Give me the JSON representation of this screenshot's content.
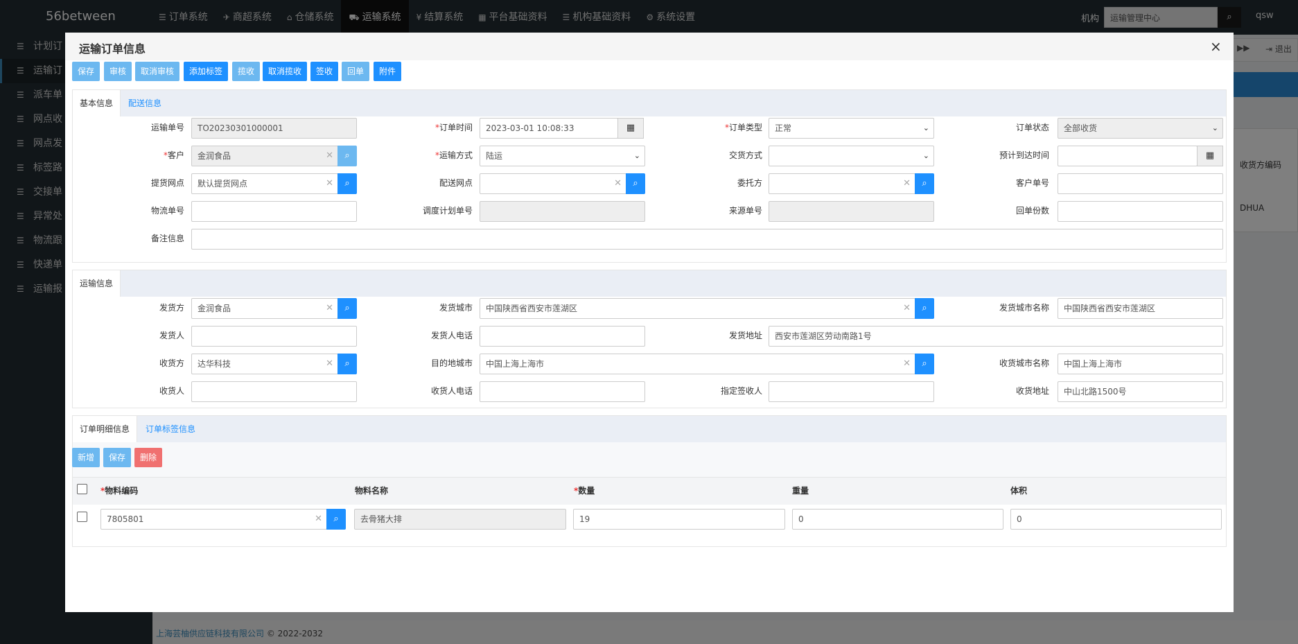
{
  "app": {
    "brand": "56between",
    "nav": [
      {
        "icon": "☰",
        "label": "订单系统"
      },
      {
        "icon": "✈",
        "label": "商超系统"
      },
      {
        "icon": "⌂",
        "label": "仓储系统"
      },
      {
        "icon": "⛟",
        "label": "运输系统"
      },
      {
        "icon": "¥",
        "label": "结算系统"
      },
      {
        "icon": "▦",
        "label": "平台基础资料"
      },
      {
        "icon": "☰",
        "label": "机构基础资料"
      },
      {
        "icon": "⚙",
        "label": "系统设置"
      }
    ],
    "org_label": "机构",
    "org_value": "运输管理中心",
    "user": "qsw",
    "sidebar": [
      "计划订",
      "运输订",
      "派车单",
      "网点收",
      "网点发",
      "标签路",
      "交接单",
      "异常处",
      "物流跟",
      "快递单",
      "运输报"
    ],
    "bg": {
      "next": "▶▶",
      "logout": "⇥ 退出",
      "col_header": "收货方编码",
      "cell": "DHUA"
    },
    "footer_company": "上海芸柚供应链科技有限公司",
    "footer_copyright": "© 2022-2032"
  },
  "modal": {
    "title": "运输订单信息",
    "close": "×",
    "toolbar": [
      "保存",
      "审核",
      "取消审核",
      "添加标签",
      "揽收",
      "取消揽收",
      "签收",
      "回单",
      "附件"
    ],
    "basic_tabs": [
      "基本信息",
      "配送信息"
    ],
    "basic": {
      "waybill_no_label": "运输单号",
      "waybill_no": "TO20230301000001",
      "order_time_label": "订单时间",
      "order_time": "2023-03-01 10:08:33",
      "order_type_label": "订单类型",
      "order_type": "正常",
      "order_status_label": "订单状态",
      "order_status": "全部收货",
      "customer_label": "客户",
      "customer": "金润食品",
      "transport_mode_label": "运输方式",
      "transport_mode": "陆运",
      "delivery_mode_label": "交货方式",
      "delivery_mode": "",
      "eta_label": "预计到达时间",
      "eta": "",
      "pickup_point_label": "提货网点",
      "pickup_point": "默认提货网点",
      "dispatch_point_label": "配送网点",
      "dispatch_point": "",
      "consignor_label": "委托方",
      "consignor": "",
      "customer_no_label": "客户单号",
      "customer_no": "",
      "logistics_no_label": "物流单号",
      "logistics_no": "",
      "plan_no_label": "调度计划单号",
      "plan_no": "",
      "source_no_label": "来源单号",
      "source_no": "",
      "receipt_copies_label": "回单份数",
      "receipt_copies": "",
      "remark_label": "备注信息",
      "remark": ""
    },
    "transport_tab": "运输信息",
    "transport": {
      "shipper_label": "发货方",
      "shipper": "金润食品",
      "ship_city_label": "发货城市",
      "ship_city": "中国陕西省西安市莲湖区",
      "ship_city_name_label": "发货城市名称",
      "ship_city_name": "中国陕西省西安市莲湖区",
      "sender_label": "发货人",
      "sender": "",
      "sender_phone_label": "发货人电话",
      "sender_phone": "",
      "ship_addr_label": "发货地址",
      "ship_addr": "西安市莲湖区劳动南路1号",
      "receiver_party_label": "收货方",
      "receiver_party": "达华科技",
      "dest_city_label": "目的地城市",
      "dest_city": "中国上海上海市",
      "recv_city_name_label": "收货城市名称",
      "recv_city_name": "中国上海上海市",
      "receiver_label": "收货人",
      "receiver": "",
      "receiver_phone_label": "收货人电话",
      "receiver_phone": "",
      "signer_label": "指定签收人",
      "signer": "",
      "recv_addr_label": "收货地址",
      "recv_addr": "中山北路1500号"
    },
    "detail_tabs": [
      "订单明细信息",
      "订单标签信息"
    ],
    "detail_toolbar": [
      "新增",
      "保存",
      "删除"
    ],
    "detail_columns": [
      "物料编码",
      "物料名称",
      "数量",
      "重量",
      "体积"
    ],
    "detail_rows": [
      {
        "code": "7805801",
        "name": "去骨猪大排",
        "qty": "19",
        "weight": "0",
        "volume": "0"
      }
    ]
  }
}
